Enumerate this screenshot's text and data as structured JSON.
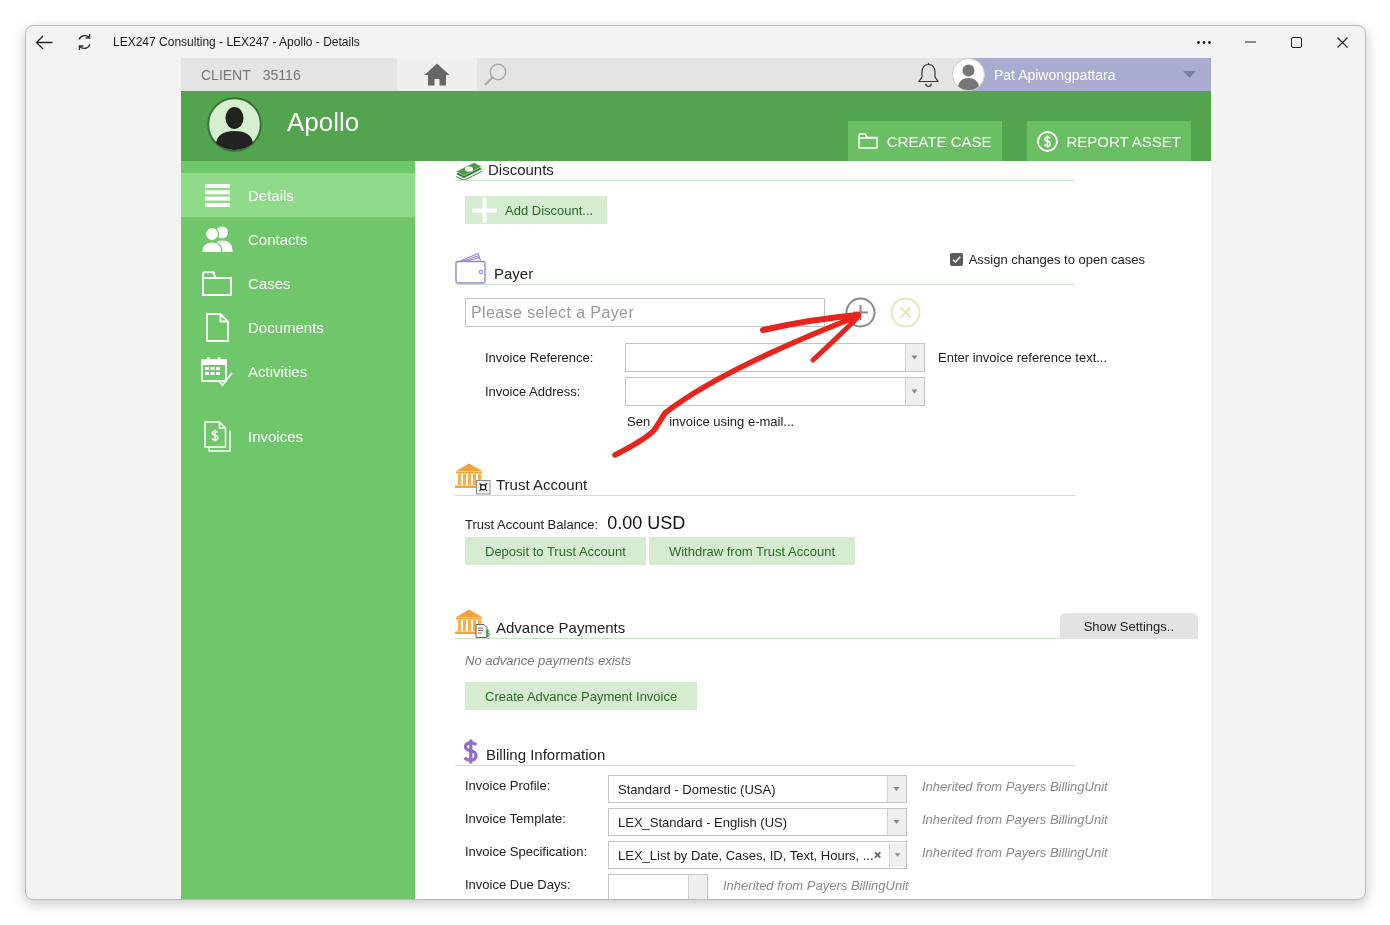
{
  "window": {
    "title": "LEX247 Consulting - LEX247 - Apollo - Details"
  },
  "top_bar": {
    "client_label": "CLIENT",
    "client_number": "35116",
    "user_name": "Pat Apiwongpattara"
  },
  "header": {
    "title": "Apollo",
    "actions": [
      "CREATE CASE",
      "REPORT ASSET"
    ]
  },
  "sidebar": {
    "groups": [
      {
        "items": [
          {
            "label": "Details",
            "selected": true
          },
          {
            "label": "Contacts",
            "selected": false
          },
          {
            "label": "Cases",
            "selected": false
          },
          {
            "label": "Documents",
            "selected": false
          },
          {
            "label": "Activities",
            "selected": false
          }
        ]
      },
      {
        "items": [
          {
            "label": "Invoices",
            "selected": false
          }
        ]
      }
    ]
  },
  "discounts": {
    "heading": "Discounts",
    "add_button": "Add Discount..."
  },
  "payer": {
    "heading": "Payer",
    "assign_changes": {
      "label": "Assign changes to open cases",
      "checked": true
    },
    "payer_field": {
      "placeholder": "Please select a Payer"
    },
    "clear_disabled": true,
    "fields": [
      {
        "label": "Invoice Reference:",
        "note": "Enter invoice reference text..."
      },
      {
        "label": "Invoice Address:"
      }
    ],
    "email_link": {
      "parts": [
        "Sen",
        "invoice using e-mail..."
      ]
    }
  },
  "trust_account": {
    "heading": "Trust Account",
    "balance_label": "Trust Account Balance:",
    "balance": "0.00 USD",
    "buttons": [
      "Deposit to Trust Account",
      "Withdraw from Trust Account"
    ]
  },
  "advance_payments": {
    "heading": "Advance Payments",
    "settings_button": "Show Settings..",
    "empty_message": "No advance payments exists",
    "buttons": [
      "Create Advance Payment Invoice"
    ]
  },
  "billing_information": {
    "heading": "Billing Information",
    "rows": [
      {
        "kind": "combo",
        "label": "Invoice Profile:",
        "value": "Standard - Domestic (USA)",
        "clearable": false,
        "note": "Inherited from Payers BillingUnit"
      },
      {
        "kind": "combo",
        "label": "Invoice Template:",
        "value": "LEX_Standard - English (US)",
        "clearable": false,
        "note": "Inherited from Payers BillingUnit"
      },
      {
        "kind": "combo",
        "label": "Invoice Specification:",
        "value": "LEX_List by Date, Cases, ID, Text, Hours, ...",
        "clearable": true,
        "note": "Inherited from Payers BillingUnit"
      },
      {
        "kind": "number",
        "label": "Invoice Due Days:",
        "note": "Inherited from Payers BillingUnit"
      }
    ]
  }
}
